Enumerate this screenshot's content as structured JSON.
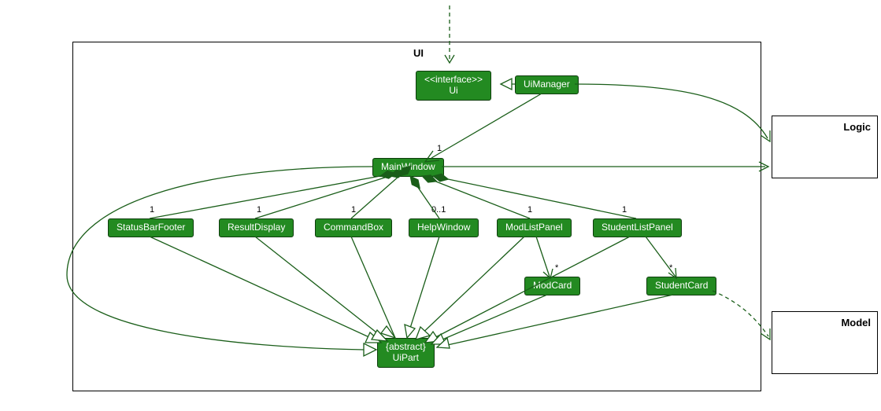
{
  "packages": {
    "ui": {
      "title": "UI"
    },
    "logic": {
      "title": "Logic"
    },
    "model": {
      "title": "Model"
    }
  },
  "classes": {
    "ui_iface": {
      "stereo": "<<interface>>",
      "name": "Ui"
    },
    "uimanager": {
      "name": "UiManager"
    },
    "mainwindow": {
      "name": "MainWindow"
    },
    "statusbar": {
      "name": "StatusBarFooter"
    },
    "resultdisplay": {
      "name": "ResultDisplay"
    },
    "commandbox": {
      "name": "CommandBox"
    },
    "helpwindow": {
      "name": "HelpWindow"
    },
    "modlistpanel": {
      "name": "ModListPanel"
    },
    "studentlistpanel": {
      "name": "StudentListPanel"
    },
    "modcard": {
      "name": "ModCard"
    },
    "studentcard": {
      "name": "StudentCard"
    },
    "uipart": {
      "stereo": "{abstract}",
      "name": "UiPart"
    }
  },
  "mults": {
    "mainwindow": "1",
    "statusbar": "1",
    "resultdisplay": "1",
    "commandbox": "1",
    "helpwindow": "0..1",
    "modlistpanel": "1",
    "studentlistpanel": "1",
    "modcard": "*",
    "studentcard": "*"
  }
}
